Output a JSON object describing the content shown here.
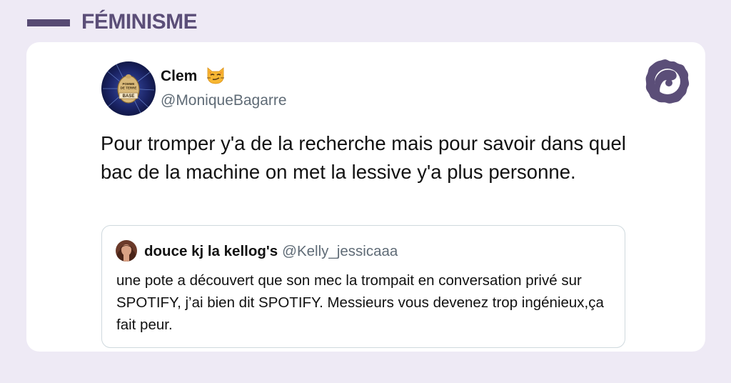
{
  "category": {
    "label": "FÉMINISME"
  },
  "tweet": {
    "author_name": "Clem",
    "author_handle": "@MoniqueBagarre",
    "avatar_text": [
      "POMME",
      "DE TERRE",
      "BASE"
    ],
    "text": "Pour tromper y'a de la recherche mais pour savoir dans quel bac de la machine on met la lessive y'a plus personne."
  },
  "quoted_tweet": {
    "author_name": "douce kj la kellog's",
    "author_handle": "@Kelly_jessicaaa",
    "text": "une pote a découvert que son mec la trompait en conversation privé sur SPOTIFY, j’ai bien dit SPOTIFY. Messieurs vous devenez trop ingénieux,ça fait peur."
  },
  "colors": {
    "background": "#eeeaf5",
    "accent": "#5b4e78",
    "handle": "#5f6b76"
  },
  "icons": {
    "author_emoji": "smirking-cat-emoji",
    "logo": "brand-logo-icon"
  }
}
